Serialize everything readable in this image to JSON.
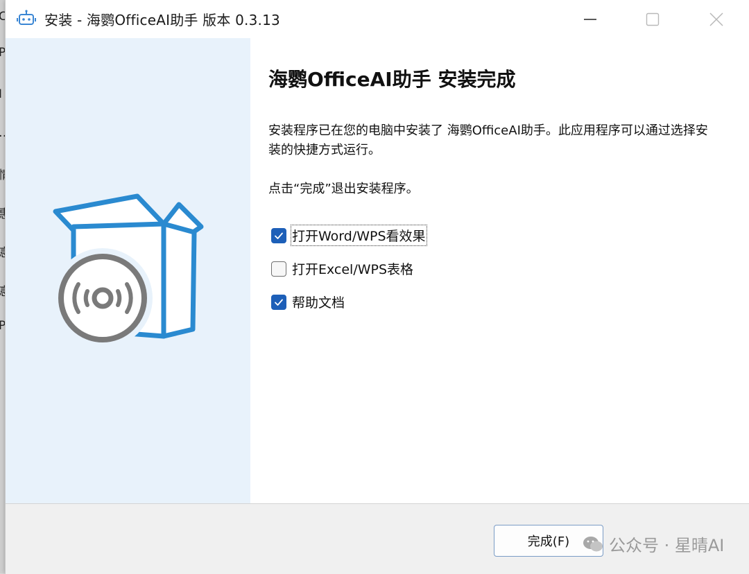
{
  "window": {
    "title": "安装 - 海鹦OfficeAI助手 版本 0.3.13"
  },
  "background_fragments": [
    "C",
    "P",
    "I",
    "…",
    "情",
    "惠",
    "悥",
    "悥",
    "P"
  ],
  "content": {
    "heading": "海鹦OfficeAI助手 安装完成",
    "paragraph1": "安装程序已在您的电脑中安装了 海鹦OfficeAI助手。此应用程序可以通过选择安装的快捷方式运行。",
    "paragraph2": "点击“完成”退出安装程序。",
    "options": [
      {
        "label": "打开Word/WPS看效果",
        "checked": true
      },
      {
        "label": "打开Excel/WPS表格",
        "checked": false
      },
      {
        "label": "帮助文档",
        "checked": true
      }
    ]
  },
  "footer": {
    "finish_label": "完成(F)",
    "watermark": "公众号 · 星晴AI"
  },
  "colors": {
    "accent": "#1d5fb8",
    "left_panel": "#e8f2fb",
    "illustration_blue": "#2a8ad0",
    "illustration_gray": "#7a7a7a"
  }
}
